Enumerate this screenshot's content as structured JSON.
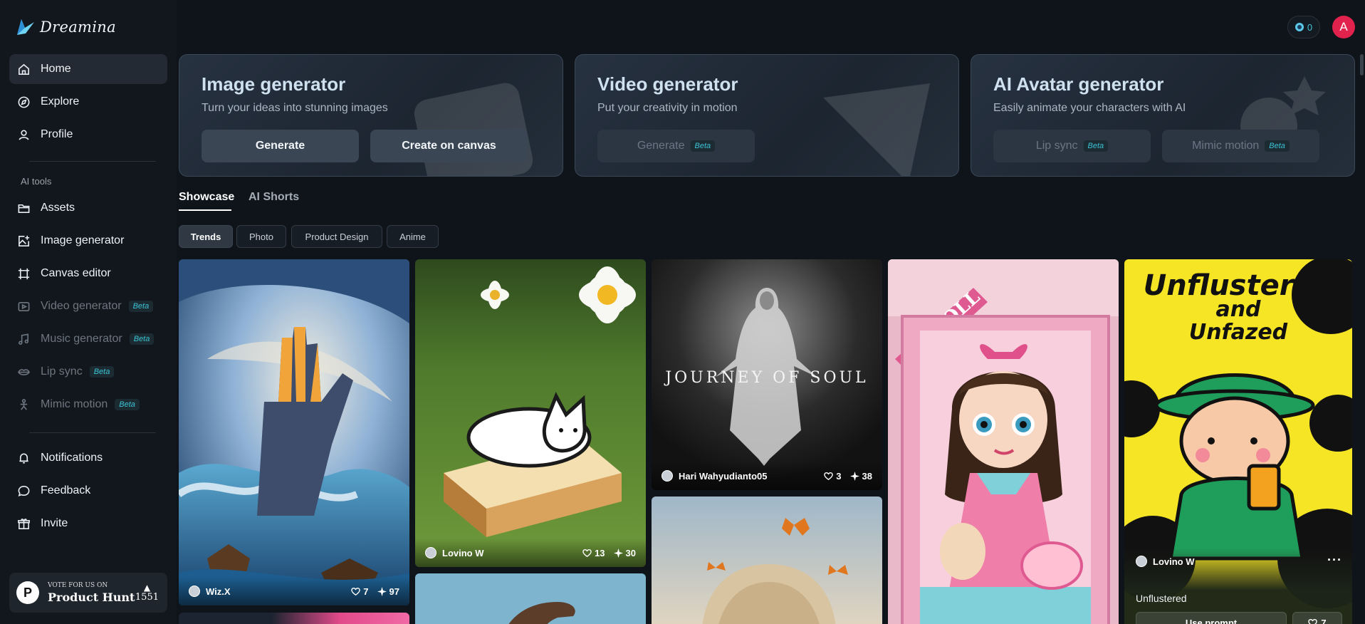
{
  "brand": {
    "name": "Dreamina"
  },
  "sidebar": {
    "nav": [
      {
        "label": "Home",
        "icon": "home-icon"
      },
      {
        "label": "Explore",
        "icon": "compass-icon"
      },
      {
        "label": "Profile",
        "icon": "user-icon"
      }
    ],
    "section_label": "AI tools",
    "tools": [
      {
        "label": "Assets",
        "icon": "folder-icon"
      },
      {
        "label": "Image generator",
        "icon": "image-plus-icon"
      },
      {
        "label": "Canvas editor",
        "icon": "canvas-icon"
      },
      {
        "label": "Video generator",
        "icon": "video-icon",
        "badge": "Beta"
      },
      {
        "label": "Music generator",
        "icon": "music-icon",
        "badge": "Beta"
      },
      {
        "label": "Lip sync",
        "icon": "lips-icon",
        "badge": "Beta"
      },
      {
        "label": "Mimic motion",
        "icon": "motion-icon",
        "badge": "Beta"
      }
    ],
    "bottom": [
      {
        "label": "Notifications",
        "icon": "bell-icon"
      },
      {
        "label": "Feedback",
        "icon": "chat-icon"
      },
      {
        "label": "Invite",
        "icon": "gift-icon"
      }
    ],
    "producthunt": {
      "line1": "VOTE FOR US ON",
      "line2": "Product Hunt",
      "votes": "1551",
      "logo_letter": "P"
    }
  },
  "topbar": {
    "credits": "0",
    "avatar_letter": "A"
  },
  "generators": [
    {
      "title": "Image generator",
      "subtitle": "Turn your ideas into stunning images",
      "buttons": [
        {
          "label": "Generate",
          "badge": ""
        },
        {
          "label": "Create on canvas",
          "badge": ""
        }
      ]
    },
    {
      "title": "Video generator",
      "subtitle": "Put your creativity in motion",
      "buttons": [
        {
          "label": "Generate",
          "badge": "Beta"
        }
      ]
    },
    {
      "title": "AI Avatar generator",
      "subtitle": "Easily animate your characters with AI",
      "buttons": [
        {
          "label": "Lip sync",
          "badge": "Beta"
        },
        {
          "label": "Mimic motion",
          "badge": "Beta"
        }
      ]
    }
  ],
  "tabs": [
    "Showcase",
    "AI Shorts"
  ],
  "filters": [
    "Trends",
    "Photo",
    "Product Design",
    "Anime"
  ],
  "gallery": [
    {
      "author": "Wiz.X",
      "likes": "7",
      "uses": "97"
    },
    {
      "author": "Lovino W",
      "likes": "13",
      "uses": "30"
    },
    {
      "author": "Hari Wahyudianto05",
      "likes": "3",
      "uses": "38",
      "art_text": "JOURNEY OF SOUL"
    },
    {
      "art_text": "DOLL"
    },
    {
      "author": "Lovino W",
      "caption": "Unflustered",
      "action": "Use prompt",
      "likes": "7",
      "art_text_1": "Unflustered",
      "art_text_2": "and",
      "art_text_3": "Unfazed"
    }
  ],
  "colors": {
    "beta": "#3bc4d6",
    "avatar": "#e1224c",
    "accent_active": "#232a33"
  }
}
